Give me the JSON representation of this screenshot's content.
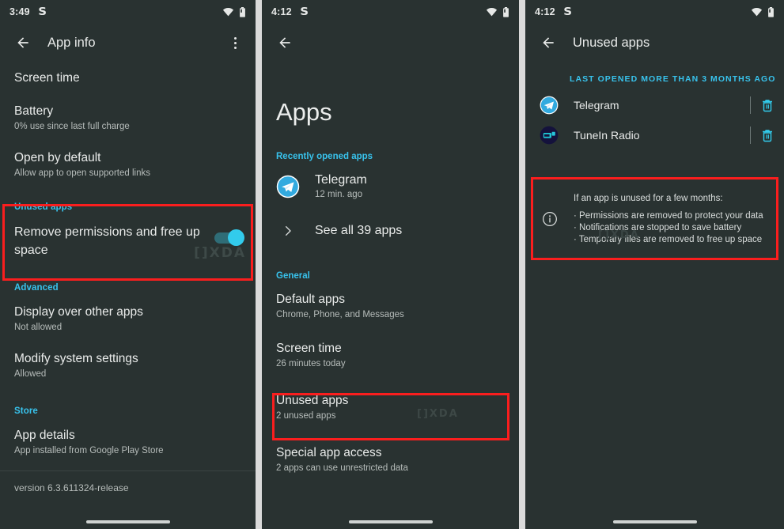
{
  "panels": [
    {
      "id": "app-info",
      "statusbar": {
        "time": "3:49",
        "glyph": "S",
        "wifi_icon": "wifi-icon",
        "battery_icon": "battery-icon"
      },
      "appbar": {
        "back_icon": "back-arrow-icon",
        "title": "App info",
        "overflow_icon": "overflow-menu-icon"
      },
      "rows": [
        {
          "title": "Screen time",
          "sub": ""
        },
        {
          "title": "Battery",
          "sub": "0% use since last full charge"
        },
        {
          "title": "Open by default",
          "sub": "Allow app to open supported links"
        }
      ],
      "unused_section": {
        "header": "Unused apps",
        "title": "Remove permissions and free up space",
        "toggle_state": "on",
        "highlight_color": "#fa1e1e"
      },
      "advanced_header": "Advanced",
      "advanced_rows": [
        {
          "title": "Display over other apps",
          "sub": "Not allowed"
        },
        {
          "title": "Modify system settings",
          "sub": "Allowed"
        }
      ],
      "store_header": "Store",
      "store_rows": [
        {
          "title": "App details",
          "sub": "App installed from Google Play Store"
        }
      ],
      "version": "version 6.3.611324-release",
      "watermark": "[]XDA"
    },
    {
      "id": "apps",
      "statusbar": {
        "time": "4:12",
        "glyph": "S",
        "wifi_icon": "wifi-icon",
        "battery_icon": "battery-icon"
      },
      "appbar": {
        "back_icon": "back-arrow-icon"
      },
      "page_title": "Apps",
      "recent_header": "Recently opened apps",
      "recent_app": {
        "name": "Telegram",
        "time": "12 min. ago",
        "icon": "telegram-icon"
      },
      "see_all": "See all 39 apps",
      "general_header": "General",
      "general_rows": [
        {
          "title": "Default apps",
          "sub": "Chrome, Phone, and Messages"
        },
        {
          "title": "Screen time",
          "sub": "26 minutes today"
        }
      ],
      "highlighted_row": {
        "title": "Unused apps",
        "sub": "2 unused apps",
        "highlight_color": "#fa1e1e"
      },
      "trailing_rows": [
        {
          "title": "Special app access",
          "sub": "2 apps can use unrestricted data"
        }
      ],
      "watermark": "[]XDA"
    },
    {
      "id": "unused-apps",
      "statusbar": {
        "time": "4:12",
        "glyph": "S",
        "wifi_icon": "wifi-icon",
        "battery_icon": "battery-icon"
      },
      "appbar": {
        "back_icon": "back-arrow-icon",
        "title": "Unused apps"
      },
      "list_header": "LAST OPENED MORE THAN 3 MONTHS AGO",
      "apps": [
        {
          "name": "Telegram",
          "icon": "telegram-icon",
          "action_icon": "delete-icon"
        },
        {
          "name": "TuneIn Radio",
          "icon": "tunein-radio-icon",
          "action_icon": "delete-icon"
        }
      ],
      "info": {
        "icon": "info-icon",
        "lead": "If an app is unused for a few months:",
        "bullets": [
          "· Permissions are removed to protect your data",
          "· Notifications are stopped to save battery",
          "· Temporary files are removed to free up space"
        ],
        "highlight_color": "#fa1e1e"
      },
      "watermark": "[]XDA"
    }
  ],
  "theme": {
    "bg": "#293231",
    "accent": "#38c3ed",
    "primary_text": "#e9ebea",
    "secondary_text": "#b6bcba",
    "highlight": "#fa1e1e"
  }
}
